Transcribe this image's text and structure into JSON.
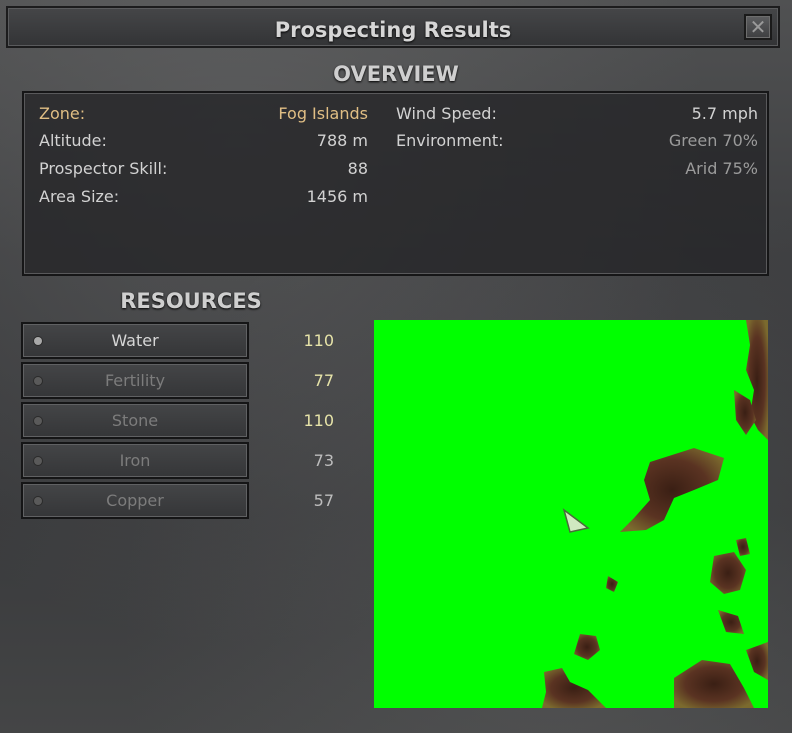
{
  "window": {
    "title": "Prospecting Results",
    "close_glyph": "✕"
  },
  "overview": {
    "heading": "OVERVIEW",
    "left": [
      {
        "label": "Zone:",
        "value": "Fog Islands"
      },
      {
        "label": "Altitude:",
        "value": "788 m"
      },
      {
        "label": "Prospector Skill:",
        "value": "88"
      },
      {
        "label": "Area Size:",
        "value": "1456 m"
      }
    ],
    "right": [
      {
        "label": "Wind Speed:",
        "value": "5.7 mph"
      },
      {
        "label": "Environment:",
        "value": "Green 70%"
      },
      {
        "label": "",
        "value": "Arid 75%"
      }
    ]
  },
  "resources": {
    "heading": "RESOURCES",
    "items": [
      {
        "label": "Water",
        "value": "110",
        "active": true
      },
      {
        "label": "Fertility",
        "value": "77",
        "active": false
      },
      {
        "label": "Stone",
        "value": "110",
        "active": false
      },
      {
        "label": "Iron",
        "value": "73",
        "active": false
      },
      {
        "label": "Copper",
        "value": "57",
        "active": false
      }
    ]
  },
  "colors": {
    "map_fill": "#00ff00",
    "terrain": "#4a2a1c",
    "zone_value": "#e0be84",
    "high_value": "#e6e3a8"
  },
  "icons": {
    "player_marker": "triangle-marker-icon",
    "close": "close-icon"
  }
}
